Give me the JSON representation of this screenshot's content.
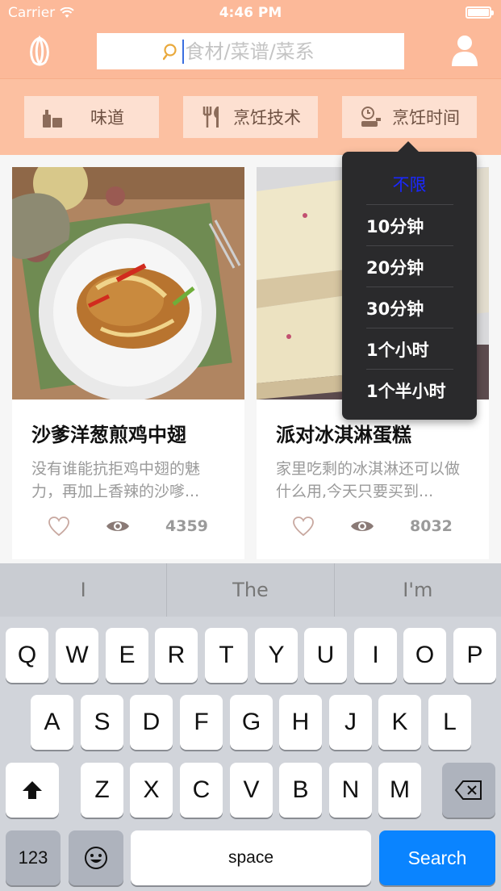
{
  "status": {
    "carrier": "Carrier",
    "time": "4:46 PM"
  },
  "search": {
    "placeholder": "食材/菜谱/菜系"
  },
  "filters": [
    {
      "label": "味道",
      "icon": "bottles-icon"
    },
    {
      "label": "烹饪技术",
      "icon": "utensils-icon"
    },
    {
      "label": "烹饪时间",
      "icon": "timer-pot-icon"
    }
  ],
  "recipes": [
    {
      "title": "沙爹洋葱煎鸡中翅",
      "desc": "没有谁能抗拒鸡中翅的魅力，再加上香辣的沙嗲...",
      "views": "4359"
    },
    {
      "title": "派对冰淇淋蛋糕",
      "desc": "家里吃剩的冰淇淋还可以做什么用,今天只要买到...",
      "views": "8032"
    }
  ],
  "time_dropdown": {
    "options": [
      "不限",
      "10分钟",
      "20分钟",
      "30分钟",
      "1个小时",
      "1个半小时"
    ],
    "selected": "不限",
    "selected_color": "#1a28ff"
  },
  "keyboard": {
    "suggestions": [
      "I",
      "The",
      "I'm"
    ],
    "row1": [
      "Q",
      "W",
      "E",
      "R",
      "T",
      "Y",
      "U",
      "I",
      "O",
      "P"
    ],
    "row2": [
      "A",
      "S",
      "D",
      "F",
      "G",
      "H",
      "J",
      "K",
      "L"
    ],
    "row3": [
      "Z",
      "X",
      "C",
      "V",
      "B",
      "N",
      "M"
    ],
    "numbers_label": "123",
    "space_label": "space",
    "search_label": "Search"
  },
  "colors": {
    "accent": "#fcb999",
    "filter_bg": "#fcc0a1",
    "search_key": "#0a84ff"
  }
}
